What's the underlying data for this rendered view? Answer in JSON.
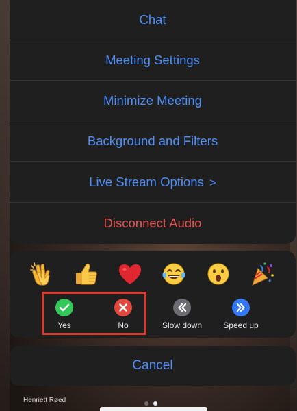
{
  "menu": {
    "items": [
      {
        "label": "Chat"
      },
      {
        "label": "Meeting Settings"
      },
      {
        "label": "Minimize Meeting"
      },
      {
        "label": "Background and Filters"
      },
      {
        "label": "Live Stream Options",
        "chevron": ">"
      },
      {
        "label": "Disconnect Audio",
        "style": "danger"
      }
    ]
  },
  "reactions": {
    "emojis": [
      "clapping-hands",
      "thumbs-up",
      "red-heart",
      "face-with-tears-of-joy",
      "face-with-open-mouth",
      "party-popper"
    ],
    "feedback": [
      {
        "label": "Yes",
        "icon": "checkmark-icon",
        "color": "#34c759"
      },
      {
        "label": "No",
        "icon": "close-icon",
        "color": "#e2483e"
      },
      {
        "label": "Slow down",
        "icon": "rewind-icon",
        "color": "#6c6c72"
      },
      {
        "label": "Speed up",
        "icon": "fast-forward-icon",
        "color": "#3478f6"
      }
    ]
  },
  "cancel_label": "Cancel",
  "participant_name": "Henriett Røed",
  "colors": {
    "accent": "#4d8ef7",
    "danger": "#e2544f",
    "highlight": "#d83a2e",
    "panel": "#1f1f20"
  }
}
